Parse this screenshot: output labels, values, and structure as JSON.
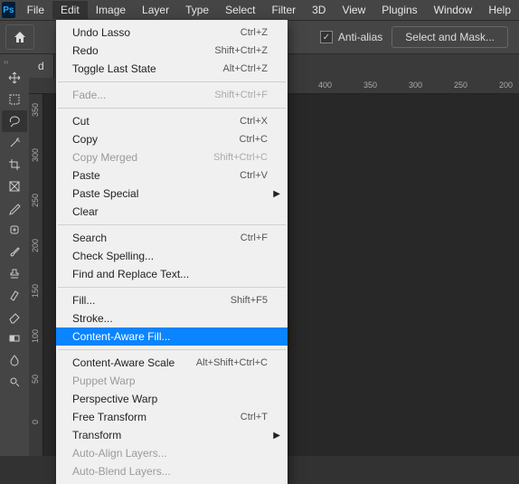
{
  "app_logo": "Ps",
  "menubar": [
    "File",
    "Edit",
    "Image",
    "Layer",
    "Type",
    "Select",
    "Filter",
    "3D",
    "View",
    "Plugins",
    "Window",
    "Help"
  ],
  "menubar_open_index": 1,
  "options": {
    "anti_alias": "Anti-alias",
    "select_mask": "Select and Mask..."
  },
  "tab": {
    "label": "d",
    "close": "×"
  },
  "ruler_h": [
    "400",
    "350",
    "300",
    "250",
    "200"
  ],
  "ruler_v": [
    "350",
    "300",
    "250",
    "200",
    "150",
    "100",
    "50",
    "0"
  ],
  "edit_menu": [
    {
      "t": "item",
      "label": "Undo Lasso",
      "shortcut": "Ctrl+Z"
    },
    {
      "t": "item",
      "label": "Redo",
      "shortcut": "Shift+Ctrl+Z"
    },
    {
      "t": "item",
      "label": "Toggle Last State",
      "shortcut": "Alt+Ctrl+Z"
    },
    {
      "t": "sep"
    },
    {
      "t": "item",
      "label": "Fade...",
      "shortcut": "Shift+Ctrl+F",
      "disabled": true
    },
    {
      "t": "sep"
    },
    {
      "t": "item",
      "label": "Cut",
      "shortcut": "Ctrl+X"
    },
    {
      "t": "item",
      "label": "Copy",
      "shortcut": "Ctrl+C"
    },
    {
      "t": "item",
      "label": "Copy Merged",
      "shortcut": "Shift+Ctrl+C",
      "disabled": true
    },
    {
      "t": "item",
      "label": "Paste",
      "shortcut": "Ctrl+V"
    },
    {
      "t": "item",
      "label": "Paste Special",
      "submenu": true
    },
    {
      "t": "item",
      "label": "Clear"
    },
    {
      "t": "sep"
    },
    {
      "t": "item",
      "label": "Search",
      "shortcut": "Ctrl+F"
    },
    {
      "t": "item",
      "label": "Check Spelling..."
    },
    {
      "t": "item",
      "label": "Find and Replace Text..."
    },
    {
      "t": "sep"
    },
    {
      "t": "item",
      "label": "Fill...",
      "shortcut": "Shift+F5"
    },
    {
      "t": "item",
      "label": "Stroke..."
    },
    {
      "t": "item",
      "label": "Content-Aware Fill...",
      "highlighted": true
    },
    {
      "t": "sep"
    },
    {
      "t": "item",
      "label": "Content-Aware Scale",
      "shortcut": "Alt+Shift+Ctrl+C"
    },
    {
      "t": "item",
      "label": "Puppet Warp",
      "disabled": true
    },
    {
      "t": "item",
      "label": "Perspective Warp"
    },
    {
      "t": "item",
      "label": "Free Transform",
      "shortcut": "Ctrl+T"
    },
    {
      "t": "item",
      "label": "Transform",
      "submenu": true
    },
    {
      "t": "item",
      "label": "Auto-Align Layers...",
      "disabled": true
    },
    {
      "t": "item",
      "label": "Auto-Blend Layers...",
      "disabled": true
    }
  ],
  "tools": [
    "move",
    "marquee",
    "lasso",
    "wand",
    "crop",
    "frame",
    "eyedropper",
    "heal",
    "brush",
    "stamp",
    "history",
    "eraser",
    "gradient",
    "blur",
    "dodge"
  ]
}
